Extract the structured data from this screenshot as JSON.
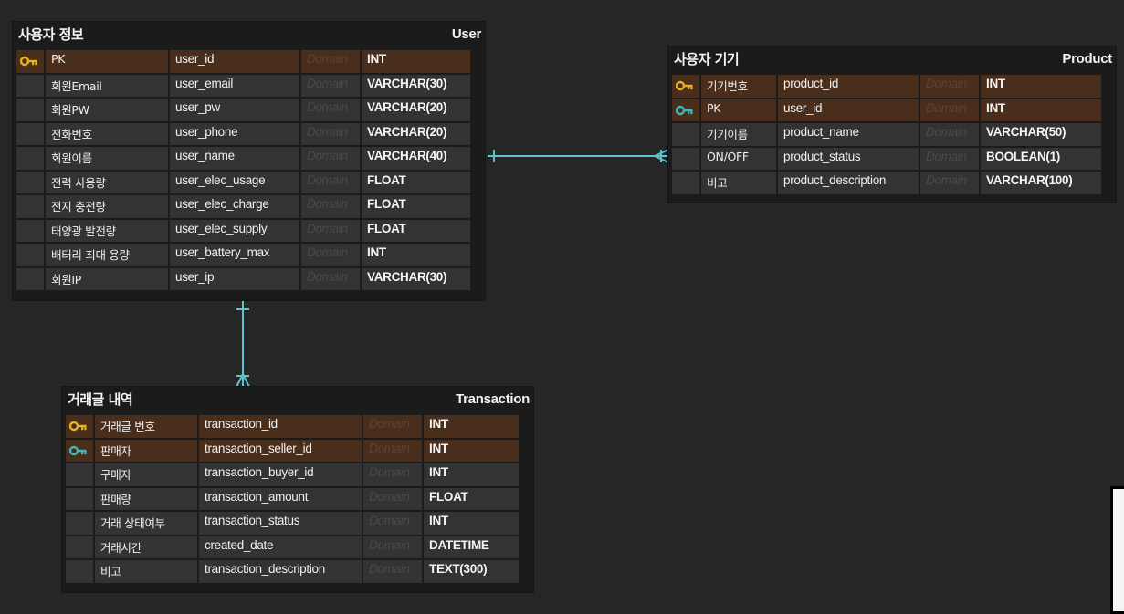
{
  "entities": {
    "user": {
      "logical_name": "사용자 정보",
      "physical_name": "User",
      "rows": [
        {
          "icon": "pk-key-icon",
          "logical": "PK",
          "physical": "user_id",
          "domain": "Domain",
          "type": "INT"
        },
        {
          "icon": "",
          "logical": "회원Email",
          "physical": "user_email",
          "domain": "Domain",
          "type": "VARCHAR(30)"
        },
        {
          "icon": "",
          "logical": "회원PW",
          "physical": "user_pw",
          "domain": "Domain",
          "type": "VARCHAR(20)"
        },
        {
          "icon": "",
          "logical": "전화번호",
          "physical": "user_phone",
          "domain": "Domain",
          "type": "VARCHAR(20)"
        },
        {
          "icon": "",
          "logical": "회원이름",
          "physical": "user_name",
          "domain": "Domain",
          "type": "VARCHAR(40)"
        },
        {
          "icon": "",
          "logical": "전력 사용량",
          "physical": "user_elec_usage",
          "domain": "Domain",
          "type": "FLOAT"
        },
        {
          "icon": "",
          "logical": "전지 충전량",
          "physical": "user_elec_charge",
          "domain": "Domain",
          "type": "FLOAT"
        },
        {
          "icon": "",
          "logical": "태양광 발전량",
          "physical": "user_elec_supply",
          "domain": "Domain",
          "type": "FLOAT"
        },
        {
          "icon": "",
          "logical": "배터리 최대 용량",
          "physical": "user_battery_max",
          "domain": "Domain",
          "type": "INT"
        },
        {
          "icon": "",
          "logical": "회원IP",
          "physical": "user_ip",
          "domain": "Domain",
          "type": "VARCHAR(30)"
        }
      ]
    },
    "product": {
      "logical_name": "사용자 기기",
      "physical_name": "Product",
      "rows": [
        {
          "icon": "pk-key-icon",
          "logical": "기기번호",
          "physical": "product_id",
          "domain": "Domain",
          "type": "INT"
        },
        {
          "icon": "fk-key-icon",
          "logical": "PK",
          "physical": "user_id",
          "domain": "Domain",
          "type": "INT"
        },
        {
          "icon": "",
          "logical": "기기이름",
          "physical": "product_name",
          "domain": "Domain",
          "type": "VARCHAR(50)"
        },
        {
          "icon": "",
          "logical": "ON/OFF",
          "physical": "product_status",
          "domain": "Domain",
          "type": "BOOLEAN(1)"
        },
        {
          "icon": "",
          "logical": "비고",
          "physical": "product_description",
          "domain": "Domain",
          "type": "VARCHAR(100)"
        }
      ]
    },
    "transaction": {
      "logical_name": "거래글 내역",
      "physical_name": "Transaction",
      "rows": [
        {
          "icon": "pk-key-icon",
          "logical": "거래글 번호",
          "physical": "transaction_id",
          "domain": "Domain",
          "type": "INT"
        },
        {
          "icon": "fk-key-icon",
          "logical": "판매자",
          "physical": "transaction_seller_id",
          "domain": "Domain",
          "type": "INT"
        },
        {
          "icon": "",
          "logical": "구매자",
          "physical": "transaction_buyer_id",
          "domain": "Domain",
          "type": "INT"
        },
        {
          "icon": "",
          "logical": "판매량",
          "physical": "transaction_amount",
          "domain": "Domain",
          "type": "FLOAT"
        },
        {
          "icon": "",
          "logical": "거래 상태여부",
          "physical": "transaction_status",
          "domain": "Domain",
          "type": "INT"
        },
        {
          "icon": "",
          "logical": "거래시간",
          "physical": "created_date",
          "domain": "Domain",
          "type": "DATETIME"
        },
        {
          "icon": "",
          "logical": "비고",
          "physical": "transaction_description",
          "domain": "Domain",
          "type": "TEXT(300)"
        }
      ]
    }
  },
  "relationships": [
    {
      "from": "User",
      "to": "Product",
      "cardinality": "one-to-many"
    },
    {
      "from": "User",
      "to": "Transaction",
      "cardinality": "one-to-many"
    }
  ],
  "colors": {
    "background": "#262626",
    "pk_key": "#e8b323",
    "fk_key": "#3fb8b8",
    "relation_line": "#5ec4cc",
    "key_row": "#4a2e1c"
  }
}
